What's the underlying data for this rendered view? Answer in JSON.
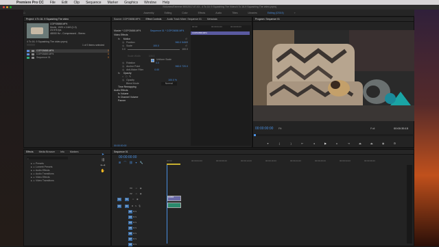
{
  "menubar": {
    "app": "Premiere Pro CC",
    "items": [
      "File",
      "Edit",
      "Clip",
      "Sequence",
      "Marker",
      "Graphics",
      "Window",
      "Help"
    ],
    "right": [
      "Sun 8:30 PM"
    ]
  },
  "window": {
    "title": "/Volumes/Extreme 900/2017-07-03 - 4 To 16: 9 Squashing The Video/4 To 16-9 Squashing The video.prproj"
  },
  "workspaces": [
    "Assembly",
    "Editing",
    "Color",
    "Effects",
    "Audio",
    "Titles",
    "Libraries",
    "Editing (CS5.5)"
  ],
  "project": {
    "title": "Project: 4 To 16- 9 Squashing The video",
    "file_name": "COP03658.MP4",
    "meta1": "Movie, 1920 x 1440 (1.0)",
    "meta2": "23.976 fps",
    "meta3": "48000 Hz - Compressed - Stereo",
    "project_file": "4 To 16- 9 Squashing The video.prproj",
    "count": "1 of 3 items selected",
    "items": [
      {
        "name": "COP03658.MP4",
        "color": "#5a8ad8",
        "num": "0"
      },
      {
        "name": "COP03659.MP4",
        "color": "#5a8ad8",
        "num": "0"
      },
      {
        "name": "Sequence 01",
        "color": "#2faa7a",
        "num": "0"
      }
    ]
  },
  "effects_panel": {
    "tabs": [
      "Effects",
      "Media Browser",
      "Info",
      "Markers"
    ],
    "folders": [
      "Presets",
      "Lumetri Presets",
      "Audio Effects",
      "Audio Transitions",
      "Video Effects",
      "Video Transitions"
    ]
  },
  "effect_controls": {
    "tabs": [
      "Source: COP03658.MP4",
      "Effect Controls",
      "Audio Track Mixer: Sequence 01",
      "Metadata"
    ],
    "master": "Master * COP03658.MP4",
    "seq_clip": "Sequence 01 * COP03658.MP4",
    "video_effects": "Video Effects",
    "motion": "Motion",
    "position_label": "Position",
    "position_val": "960.0    540.0",
    "scale_label": "Scale",
    "scale_val": "100.0",
    "scale_min": "0.0",
    "scale_max": "100.0",
    "scale_width_label": "Scale Width",
    "scale_width_val": "100.0",
    "uniform_scale": "Uniform Scale",
    "rotation_label": "Rotation",
    "rotation_val": "0.0",
    "anchor_label": "Anchor Point",
    "anchor_val": "960.0    720.0",
    "antiflicker_label": "Anti-flicker Filter",
    "antiflicker_val": "0.00",
    "opacity": "Opacity",
    "opacity_label": "Opacity",
    "opacity_val": "100.0 %",
    "blend_label": "Blend Mode",
    "blend_val": "Normal",
    "time_remap": "Time Remapping",
    "audio_effects": "Audio Effects",
    "volume": "Volume",
    "channel_volume": "Channel Volume",
    "panner": "Panner",
    "timecode": "00:00:00:00",
    "ruler": [
      "00:00",
      "00:00:04:23",
      "00:00:09:23"
    ],
    "clip_label": "COP03658.MP4"
  },
  "program": {
    "tab": "Program: Sequence 01",
    "timecode": "00:00:00:00",
    "fit": "Fit",
    "full": "Full",
    "duration": "00:00:35:15"
  },
  "timeline": {
    "tab": "Sequence 01",
    "timecode": "00:00:00:00",
    "ruler": [
      "00:00",
      "00:00:04:23",
      "00:00:09:23",
      "00:00:14:23",
      "00:00:19:23",
      "00:00:24:23",
      "00:00:29:23",
      "00:00:34:23",
      "00:00:39:23",
      "00:00:44:23",
      "00:00:49:23",
      "00:00:54:23",
      "00:00:59:22"
    ],
    "video_tracks": [
      "V3",
      "V2",
      "V1"
    ],
    "audio_tracks": [
      "A1",
      "A2",
      "A3",
      "A4",
      "A5",
      "A6",
      "A7",
      "A8"
    ],
    "clip_v": "COP03",
    "clip_a": ""
  }
}
